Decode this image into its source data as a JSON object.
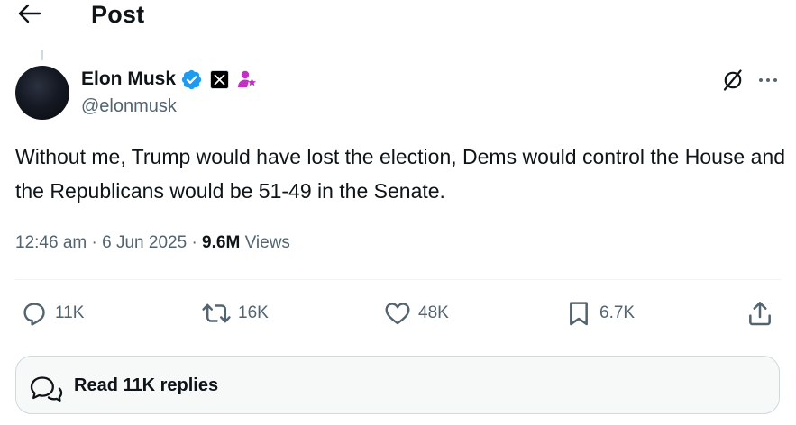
{
  "header": {
    "title": "Post",
    "back_icon": "arrow-left-icon"
  },
  "author": {
    "display_name": "Elon Musk",
    "handle": "@elonmusk",
    "verified_icon": "verified-badge-icon",
    "verified_color": "#1d9bf0",
    "affiliate_icon": "x-logo-icon",
    "gov_icon": "government-official-icon",
    "gov_color": "#c52fc5"
  },
  "post": {
    "text": "Without me, Trump would have lost the election, Dems would control the House and the Republicans would be 51-49 in the Senate.",
    "time": "12:46 am",
    "date": "6 Jun 2025",
    "separator": "·",
    "views_count": "9.6M",
    "views_label": "Views"
  },
  "top_actions": {
    "grok_icon": "grok-icon",
    "more_icon": "more-horizontal-icon"
  },
  "actions": {
    "reply": {
      "icon": "reply-icon",
      "count": "11K"
    },
    "repost": {
      "icon": "repost-icon",
      "count": "16K"
    },
    "like": {
      "icon": "heart-icon",
      "count": "48K"
    },
    "bookmark": {
      "icon": "bookmark-icon",
      "count": "6.7K"
    },
    "share": {
      "icon": "share-icon"
    }
  },
  "replies_banner": {
    "label": "Read 11K replies",
    "icon": "chat-bubbles-icon"
  },
  "colors": {
    "text_primary": "#0f1419",
    "text_secondary": "#536471",
    "border": "#cfd9de",
    "banner_bg": "#f7f9f9"
  }
}
